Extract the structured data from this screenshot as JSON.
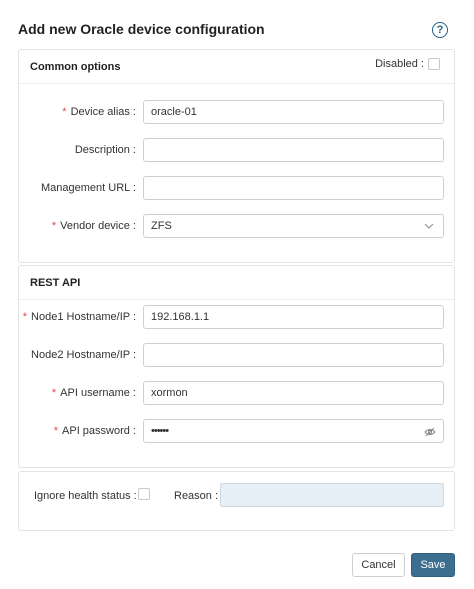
{
  "dialog": {
    "title": "Add new Oracle device configuration",
    "help_icon": "question-circle-icon"
  },
  "common": {
    "header": "Common options",
    "disabled_label": "Disabled :",
    "disabled_checked": false,
    "device_alias": {
      "label": "Device alias :",
      "value": "oracle-01",
      "required": true
    },
    "description": {
      "label": "Description :",
      "value": ""
    },
    "management_url": {
      "label": "Management URL :",
      "value": ""
    },
    "vendor_device": {
      "label": "Vendor device :",
      "value": "ZFS",
      "required": true
    }
  },
  "rest": {
    "header": "REST API",
    "node1": {
      "label": "Node1 Hostname/IP :",
      "value": "192.168.1.1",
      "required": true
    },
    "node2": {
      "label": "Node2 Hostname/IP :",
      "value": ""
    },
    "api_username": {
      "label": "API username :",
      "value": "xormon",
      "required": true
    },
    "api_password": {
      "label": "API password :",
      "value": "••••••",
      "required": true
    }
  },
  "health": {
    "ignore_label": "Ignore health status :",
    "ignore_checked": false,
    "reason_label": "Reason :",
    "reason_value": ""
  },
  "buttons": {
    "cancel": "Cancel",
    "save": "Save"
  },
  "colors": {
    "required": "#e0474c",
    "primary_button": "#3c6e8f",
    "help_icon": "#1f5f8b",
    "reason_disabled_bg": "#e6eef6"
  }
}
